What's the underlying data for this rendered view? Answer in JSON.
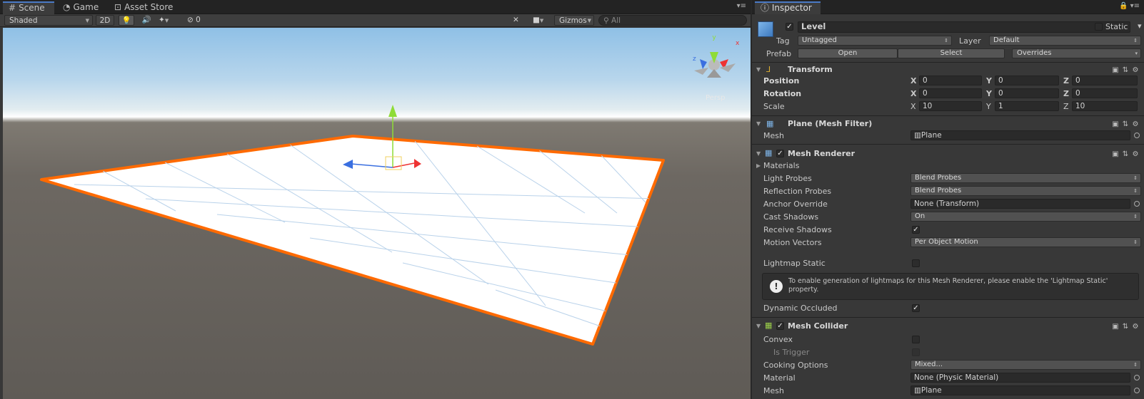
{
  "scene": {
    "tabs": [
      {
        "label": "Scene",
        "icon": "grid-icon"
      },
      {
        "label": "Game",
        "icon": "pacman-icon"
      },
      {
        "label": "Asset Store",
        "icon": "bag-icon"
      }
    ],
    "toolbar": {
      "shading": "Shaded",
      "mode_2d": "2D",
      "hidden_count": "0",
      "gizmos": "Gizmos",
      "search_placeholder": "All"
    },
    "gizmo": {
      "y": "y",
      "x": "x",
      "z": "z",
      "persp": "Persp"
    }
  },
  "inspector": {
    "tab": "Inspector",
    "object": {
      "name": "Level",
      "active": true,
      "static_label": "Static",
      "tag_label": "Tag",
      "tag": "Untagged",
      "layer_label": "Layer",
      "layer": "Default",
      "prefab_label": "Prefab",
      "open": "Open",
      "select": "Select",
      "overrides": "Overrides"
    },
    "transform": {
      "title": "Transform",
      "rows": [
        {
          "label": "Position",
          "x": "0",
          "y": "0",
          "z": "0"
        },
        {
          "label": "Rotation",
          "x": "0",
          "y": "0",
          "z": "0"
        },
        {
          "label": "Scale",
          "x": "10",
          "y": "1",
          "z": "10"
        }
      ]
    },
    "mesh_filter": {
      "title": "Plane (Mesh Filter)",
      "mesh_label": "Mesh",
      "mesh": "Plane"
    },
    "mesh_renderer": {
      "title": "Mesh Renderer",
      "materials": "Materials",
      "light_probes_label": "Light Probes",
      "light_probes": "Blend Probes",
      "reflection_probes_label": "Reflection Probes",
      "reflection_probes": "Blend Probes",
      "anchor_override_label": "Anchor Override",
      "anchor_override": "None (Transform)",
      "cast_shadows_label": "Cast Shadows",
      "cast_shadows": "On",
      "receive_shadows_label": "Receive Shadows",
      "motion_vectors_label": "Motion Vectors",
      "motion_vectors": "Per Object Motion",
      "lightmap_static_label": "Lightmap Static",
      "info": "To enable generation of lightmaps for this Mesh Renderer, please enable the 'Lightmap Static' property.",
      "dynamic_occluded_label": "Dynamic Occluded"
    },
    "mesh_collider": {
      "title": "Mesh Collider",
      "convex_label": "Convex",
      "is_trigger_label": "Is Trigger",
      "cooking_label": "Cooking Options",
      "cooking": "Mixed...",
      "material_label": "Material",
      "material": "None (Physic Material)",
      "mesh_label": "Mesh",
      "mesh": "Plane"
    }
  },
  "colors": {
    "selection_outline": "#ff6a00",
    "tab_accent": "#4a7ac6",
    "panel_bg": "#383838"
  }
}
